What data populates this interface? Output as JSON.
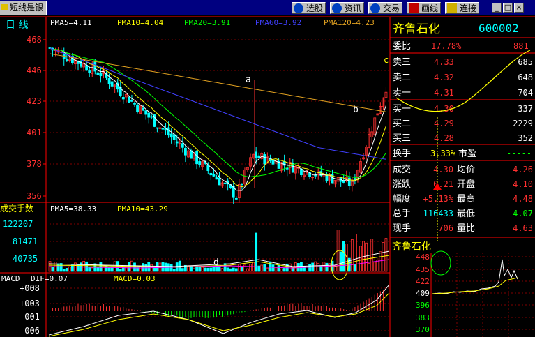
{
  "app": {
    "title": "短线是银"
  },
  "toolbar": {
    "items": [
      {
        "label": "选股"
      },
      {
        "label": "资讯"
      },
      {
        "label": "交易"
      },
      {
        "label": "画线"
      },
      {
        "label": "连接"
      }
    ],
    "window_buttons": [
      "_",
      "□",
      "×"
    ]
  },
  "kline": {
    "period_label": "日 线",
    "ma_legend": [
      {
        "label": "PMA5=4.11",
        "color": "#ffffff"
      },
      {
        "label": "PMA10=4.04",
        "color": "#ffff00"
      },
      {
        "label": "PMA20=3.91",
        "color": "#00ff00"
      },
      {
        "label": "PMA60=3.92",
        "color": "#4040ff"
      },
      {
        "label": "PMA120=4.23",
        "color": "#e0a020"
      }
    ],
    "y_ticks": [
      "468",
      "446",
      "423",
      "401",
      "378",
      "356"
    ],
    "annotations": {
      "a": "a",
      "b": "b",
      "c": "c",
      "d": "d"
    }
  },
  "volume": {
    "title": "成交手数",
    "ma_legend": [
      {
        "label": "PMA5=38.33",
        "color": "#ffffff"
      },
      {
        "label": "PMA10=43.29",
        "color": "#ffff00"
      }
    ],
    "y_ticks": [
      "122207",
      "81471",
      "40735"
    ]
  },
  "macd": {
    "title": "MACD",
    "legend": [
      {
        "label": "DIF=0.07",
        "color": "#ffffff"
      },
      {
        "label": "MACD=0.03",
        "color": "#ffff00"
      }
    ],
    "y_ticks": [
      "+008",
      "+003",
      "-001",
      "-006"
    ]
  },
  "quote": {
    "name": "齐鲁石化",
    "code": "600002",
    "weibi": {
      "label": "委比",
      "pct": "17.78%",
      "diff": "881"
    },
    "asks": [
      {
        "label": "卖三",
        "price": "4.33",
        "vol": "685"
      },
      {
        "label": "卖二",
        "price": "4.32",
        "vol": "648"
      },
      {
        "label": "卖一",
        "price": "4.31",
        "vol": "704"
      }
    ],
    "bids": [
      {
        "label": "买一",
        "price": "4.30",
        "vol": "337"
      },
      {
        "label": "买二",
        "price": "4.29",
        "vol": "2229"
      },
      {
        "label": "买三",
        "price": "4.28",
        "vol": "352"
      }
    ],
    "turnover": {
      "label": "换手",
      "value": "3.33%",
      "label2": "市盈",
      "value2": "-----"
    },
    "stats": [
      {
        "l1": "成交",
        "v1": "4.30",
        "l2": "均价",
        "v2": "4.26"
      },
      {
        "l1": "涨跌",
        "v1": "0.21",
        "l2": "开盘",
        "v2": "4.10"
      },
      {
        "l1": "幅度",
        "v1": "+5.13%",
        "l2": "最高",
        "v2": "4.48"
      },
      {
        "l1": "总手",
        "v1": "116433",
        "l2": "最低",
        "v2": "4.07"
      },
      {
        "l1": "现手",
        "v1": "706",
        "l2": "量比",
        "v2": "4.63"
      }
    ]
  },
  "intraday": {
    "title": "齐鲁石化",
    "y_ticks": [
      "448",
      "435",
      "422",
      "409",
      "396",
      "383",
      "370"
    ]
  },
  "colors": {
    "up": "#ff3030",
    "down": "#00ffff",
    "grid": "#800000",
    "axis": "#ff0000"
  }
}
